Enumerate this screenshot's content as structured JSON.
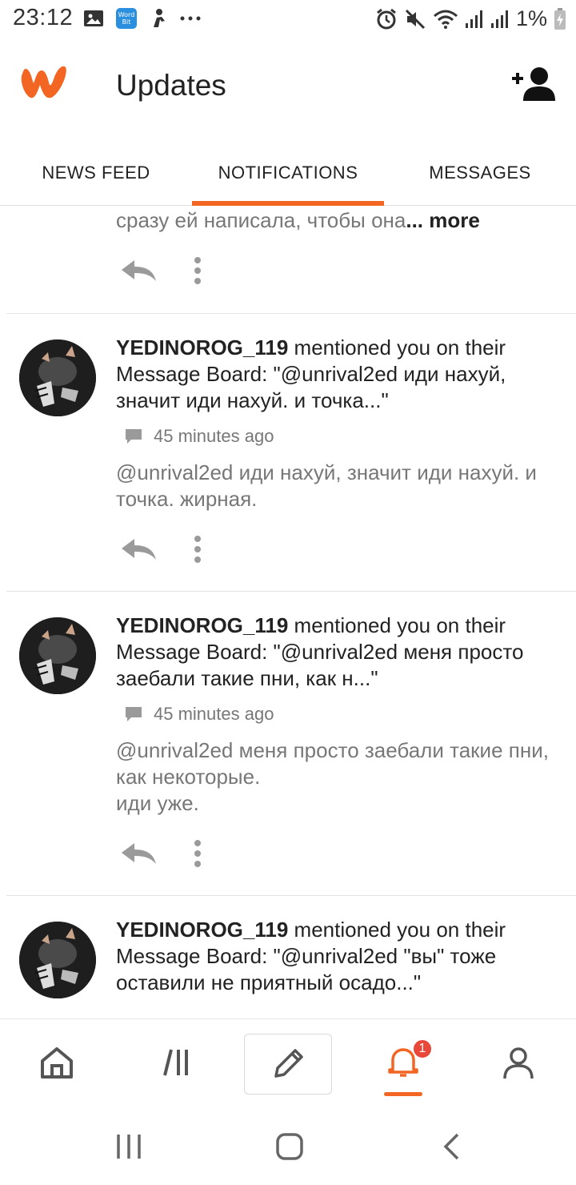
{
  "status_bar": {
    "time": "23:12",
    "battery_text": "1%",
    "left_icons": [
      "gallery-icon",
      "wordbit-app-icon",
      "figure-icon",
      "more-dots-icon"
    ],
    "right_icons": [
      "alarm-icon",
      "mute-icon",
      "wifi-icon",
      "signal-icon",
      "signal-icon",
      "battery-charging-icon"
    ]
  },
  "header": {
    "title": "Updates",
    "logo_color": "#f26522"
  },
  "tabs": [
    {
      "label": "NEWS FEED"
    },
    {
      "label": "NOTIFICATIONS",
      "active": true
    },
    {
      "label": "MESSAGES"
    }
  ],
  "feed": {
    "partial_item": {
      "text": "сразу ей написала, чтобы она",
      "more_label": "... more"
    },
    "items": [
      {
        "user": "YEDINOROG_119",
        "action": " mentioned you on their Message Board: \"@unrival2ed иди нахуй, значит иди нахуй. и точка...\"",
        "time": "45 minutes ago",
        "body": "@unrival2ed  иди нахуй, значит иди нахуй. и точка. жирная."
      },
      {
        "user": "YEDINOROG_119",
        "action": " mentioned you on their Message Board: \"@unrival2ed меня просто заебали такие пни, как н...\"",
        "time": "45 minutes ago",
        "body": "@unrival2ed  меня просто заебали такие пни, как некоторые.\nиди уже."
      },
      {
        "user": "YEDINOROG_119",
        "action": " mentioned you on their Message Board: \"@unrival2ed \"вы\" тоже оставили не приятный осадо...\""
      }
    ]
  },
  "bottom_nav": {
    "items": [
      "home-icon",
      "library-icon",
      "write-icon",
      "notifications-icon",
      "profile-icon"
    ],
    "active": "notifications-icon",
    "notification_badge": "1",
    "accent": "#f26522"
  }
}
